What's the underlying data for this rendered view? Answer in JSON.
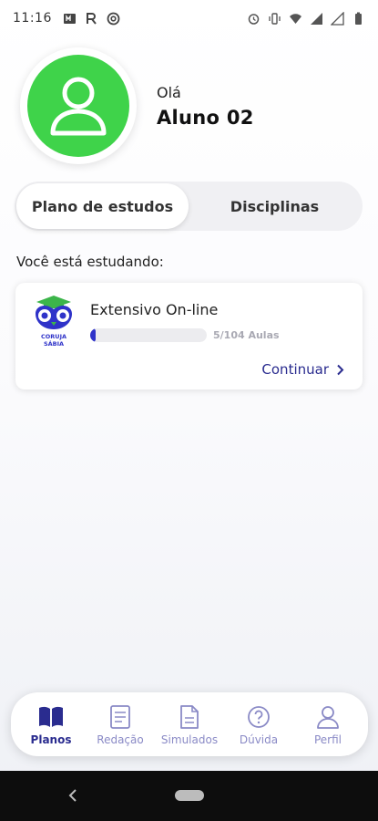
{
  "status_bar": {
    "time": "11:16",
    "left_icons": [
      "media-icon",
      "r-app-icon",
      "at-icon"
    ],
    "right_icons": [
      "alarm-icon",
      "vibrate-icon",
      "wifi-icon",
      "signal-icon",
      "signal-icon-2",
      "battery-icon"
    ]
  },
  "profile": {
    "greeting": "Olá",
    "name": "Aluno 02",
    "avatar_color": "#3fd34a"
  },
  "tabs": [
    {
      "label": "Plano de estudos",
      "active": true
    },
    {
      "label": "Disciplinas",
      "active": false
    }
  ],
  "section_label": "Você está estudando:",
  "course": {
    "logo_text": "CORUJA SÁBIA",
    "title": "Extensivo On-line",
    "progress_text": "5/104 Aulas",
    "progress_fraction": 0.048,
    "continue_label": "Continuar",
    "accent": "#2f33c9"
  },
  "bottom_nav": [
    {
      "label": "Planos",
      "icon": "book-icon",
      "active": true
    },
    {
      "label": "Redação",
      "icon": "document-icon",
      "active": false
    },
    {
      "label": "Simulados",
      "icon": "file-icon",
      "active": false
    },
    {
      "label": "Dúvida",
      "icon": "question-icon",
      "active": false
    },
    {
      "label": "Perfil",
      "icon": "person-icon",
      "active": false
    }
  ]
}
